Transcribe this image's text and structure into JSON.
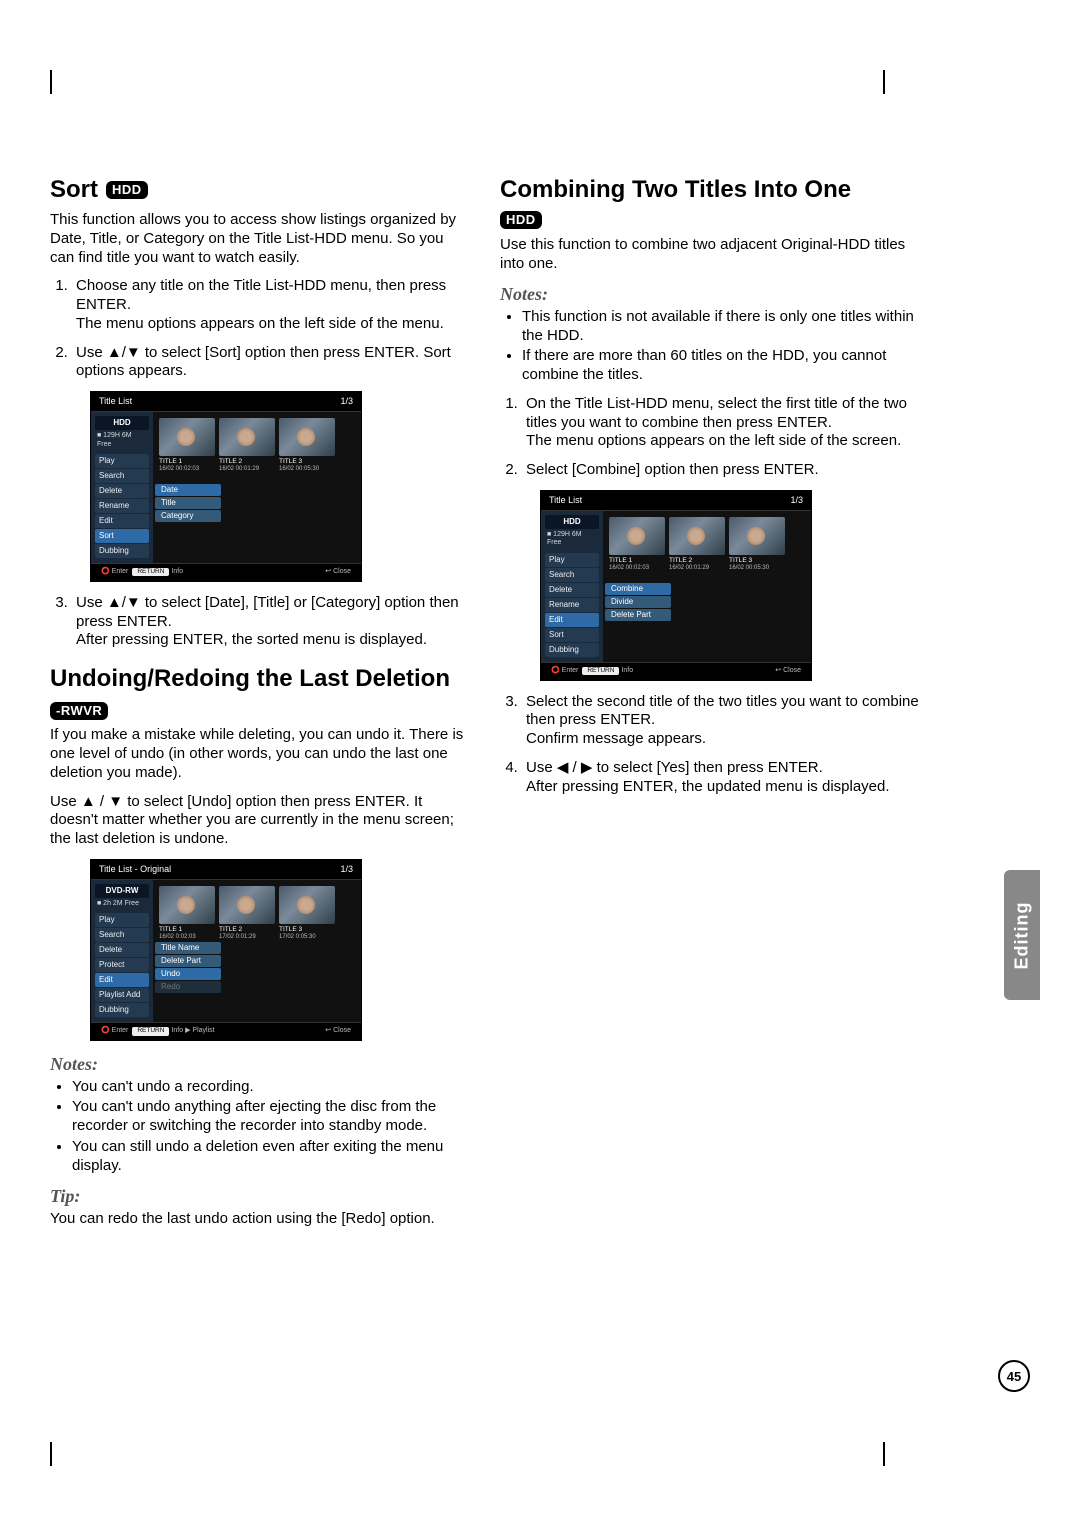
{
  "page_number": "45",
  "side_tab": "Editing",
  "left": {
    "sort": {
      "heading": "Sort",
      "badge": "HDD",
      "intro": "This function allows you to access show listings organized by Date, Title, or Category on the Title List-HDD menu. So you can find title you want to watch easily.",
      "steps": {
        "s1a": "Choose any title on the Title List-HDD menu, then press ENTER.",
        "s1b": "The menu options appears on the left side of the menu.",
        "s2": "Use ▲/▼ to select [Sort] option then press ENTER. Sort options appears.",
        "s3a": "Use ▲/▼ to select [Date], [Title] or [Category] option then press ENTER.",
        "s3b": "After pressing ENTER, the sorted menu is displayed."
      }
    },
    "undo": {
      "heading": "Undoing/Redoing the Last Deletion",
      "badge": "-RWVR",
      "p1": "If you make a mistake while deleting, you can undo it. There is one level of undo (in other words, you can undo the last one deletion you made).",
      "p2": "Use ▲ / ▼ to select [Undo] option then press ENTER. It doesn't matter whether you are currently in the menu screen; the last deletion is undone.",
      "notes_h": "Notes:",
      "notes": {
        "n1": "You can't undo a recording.",
        "n2": "You can't undo anything after ejecting the disc from the recorder or switching the recorder into standby mode.",
        "n3": "You can still undo a deletion even after exiting the menu display."
      },
      "tip_h": "Tip:",
      "tip": "You can redo the last undo action using the [Redo] option."
    }
  },
  "right": {
    "combine": {
      "heading": "Combining Two Titles Into One",
      "badge": "HDD",
      "intro": "Use this function to combine two adjacent Original-HDD titles into one.",
      "notes_h": "Notes:",
      "notes": {
        "n1": "This function is not available if there is only one titles within the HDD.",
        "n2": "If there are more than 60 titles on the HDD, you cannot combine the titles."
      },
      "steps": {
        "s1a": "On the Title List-HDD menu, select the first title of the two titles you want to combine then press ENTER.",
        "s1b": "The menu options appears on the left side of the screen.",
        "s2": "Select [Combine] option then press ENTER.",
        "s3a": "Select the second title of the two titles you want to combine then press ENTER.",
        "s3b": "Confirm message appears.",
        "s4a": "Use ◀ / ▶ to select [Yes] then press ENTER.",
        "s4b": "After pressing ENTER, the updated menu is displayed."
      }
    }
  },
  "shot1": {
    "header_left": "Title List",
    "header_right": "1/3",
    "side_top": "HDD",
    "side_cap": "■ 129H 6M Free",
    "menu": [
      "Play",
      "Search",
      "Delete",
      "Rename",
      "Edit",
      "Sort",
      "Dubbing"
    ],
    "menu_hl_index": 5,
    "submenu": [
      "Date",
      "Title",
      "Category"
    ],
    "titles": [
      {
        "name": "TITLE 1",
        "sub": "16/02  00:02:03"
      },
      {
        "name": "TITLE 2",
        "sub": "16/02  00:01:29"
      },
      {
        "name": "TITLE 3",
        "sub": "16/02  00:05:30"
      }
    ],
    "footer_left": "⭕ Enter",
    "footer_mid": "Info",
    "footer_right": "↩ Close"
  },
  "shot2": {
    "header_left": "Title List - Original",
    "header_right": "1/3",
    "side_top": "DVD-RW",
    "side_cap": "■ 2h 2M Free",
    "menu": [
      "Play",
      "Search",
      "Delete",
      "Protect",
      "Edit",
      "Playlist Add",
      "Dubbing"
    ],
    "menu_hl_index": 4,
    "submenu": [
      "Title Name",
      "Delete Part",
      "Undo",
      "Redo"
    ],
    "titles": [
      {
        "name": "TITLE 1",
        "sub": "16/02  0:02:03"
      },
      {
        "name": "TITLE 2",
        "sub": "17/02  0:01:29"
      },
      {
        "name": "TITLE 3",
        "sub": "17/02  0:05:30"
      }
    ],
    "footer_left": "⭕ Enter",
    "footer_mid": "Info  ▶ Playlist",
    "footer_right": "↩ Close"
  },
  "shot3": {
    "header_left": "Title List",
    "header_right": "1/3",
    "side_top": "HDD",
    "side_cap": "■ 129H 6M Free",
    "menu": [
      "Play",
      "Search",
      "Delete",
      "Rename",
      "Edit",
      "Sort",
      "Dubbing"
    ],
    "menu_hl_index": 4,
    "submenu": [
      "Combine",
      "Divide",
      "Delete Part"
    ],
    "titles": [
      {
        "name": "TITLE 1",
        "sub": "16/02  00:02:03"
      },
      {
        "name": "TITLE 2",
        "sub": "16/02  00:01:29"
      },
      {
        "name": "TITLE 3",
        "sub": "16/02  00:05:30"
      }
    ],
    "footer_left": "⭕ Enter",
    "footer_mid": "Info",
    "footer_right": "↩ Close"
  }
}
